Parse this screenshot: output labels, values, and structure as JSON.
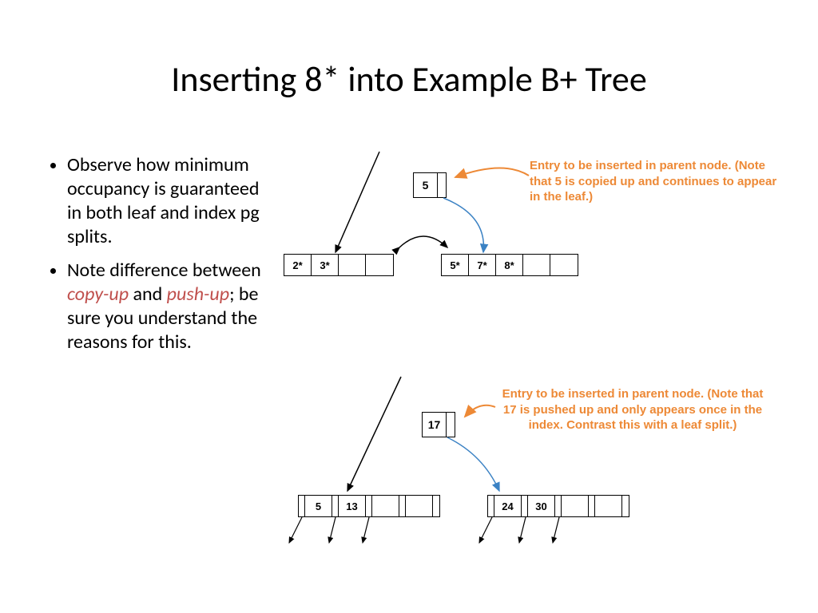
{
  "title": "Inserting 8* into Example B+ Tree",
  "bullets": {
    "item1": "Observe how minimum occupancy is guaranteed in both leaf and index pg splits.",
    "item2_pre": "Note difference between ",
    "item2_em1": "copy-up",
    "item2_mid": " and ",
    "item2_em2": "push-up",
    "item2_post": "; be sure you understand the reasons for this."
  },
  "diagram1": {
    "parent_key": "5",
    "leaf_left": [
      "2*",
      "3*",
      "",
      ""
    ],
    "leaf_right": [
      "5*",
      "7*",
      "8*",
      "",
      ""
    ],
    "annotation": "Entry to be inserted in parent node. (Note that 5 is copied up and continues to appear in the leaf.)"
  },
  "diagram2": {
    "parent_key": "17",
    "index_left": [
      "5",
      "13",
      "",
      "",
      ""
    ],
    "index_right": [
      "24",
      "30",
      "",
      "",
      ""
    ],
    "annotation": "Entry to be inserted in parent node. (Note that 17 is pushed up and only appears once in the index. Contrast this with a leaf split.)"
  }
}
